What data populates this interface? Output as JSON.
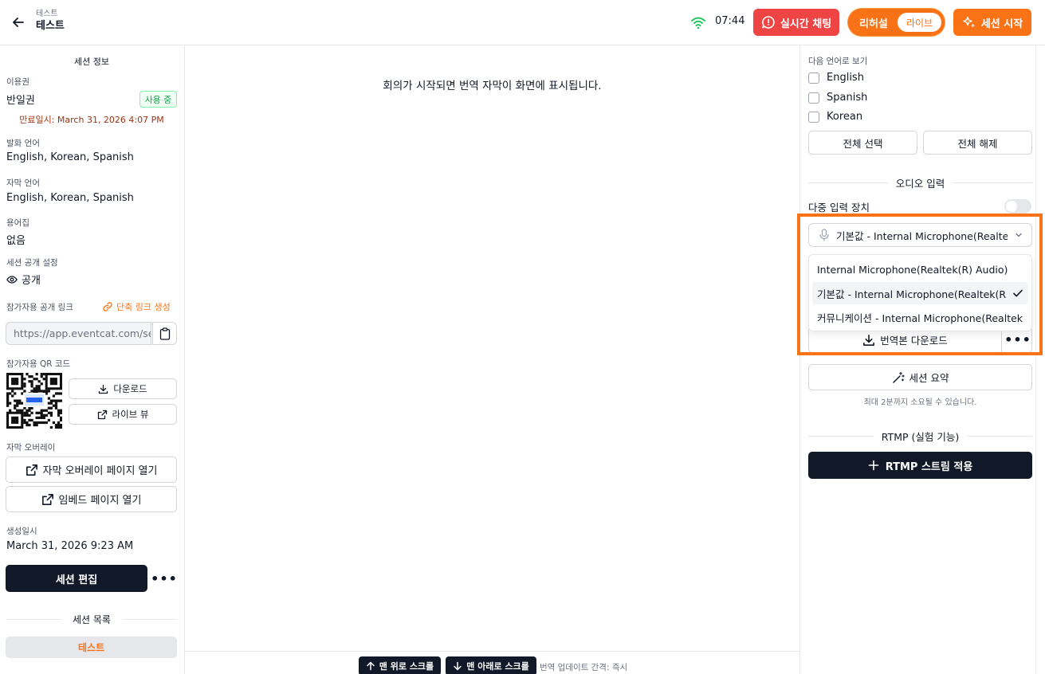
{
  "header": {
    "subtitle": "테스트",
    "title": "테스트",
    "time": "07:44",
    "chat_label": "실시간 채팅",
    "mode_rehearsal": "리허설",
    "mode_live": "라이브",
    "start_label": "세션 시작"
  },
  "left": {
    "panel_title": "세션 정보",
    "license_label": "이용권",
    "license_value": "반일권",
    "license_badge": "사용 중",
    "expire_text": "만료일시: March 31, 2026 4:07 PM",
    "speech_lang_label": "발화 언어",
    "speech_lang_value": "English, Korean, Spanish",
    "subtitle_lang_label": "자막 언어",
    "subtitle_lang_value": "English, Korean, Spanish",
    "glossary_label": "용어집",
    "glossary_value": "없음",
    "visibility_label": "세션 공개 설정",
    "visibility_value": "공개",
    "public_link_label": "참가자용 공개 링크",
    "short_link_label": "단축 링크 생성",
    "public_link_value": "https://app.eventcat.com/session/",
    "qr_label": "참가자용 QR 코드",
    "download_label": "다운로드",
    "live_view_label": "라이브 뷰",
    "overlay_label": "자막 오버레이",
    "overlay_open_label": "자막 오버레이 페이지 열기",
    "embed_open_label": "임베드 페이지 열기",
    "created_label": "생성일시",
    "created_value": "March 31, 2026 9:23 AM",
    "edit_label": "세션 편집",
    "list_title": "세션 목록",
    "list_items": [
      "테스트"
    ]
  },
  "center": {
    "placeholder": "회의가 시작되면 번역 자막이 화면에 표시됩니다.",
    "scroll_top_label": "맨 위로 스크롤",
    "scroll_bottom_label": "맨 아래로 스크롤",
    "update_interval": "번역 업데이트 간격: 즉시"
  },
  "right": {
    "view_lang_label": "다음 언어로 보기",
    "languages": [
      "English",
      "Spanish",
      "Korean"
    ],
    "select_all_label": "전체 선택",
    "deselect_all_label": "전체 해제",
    "audio_input_title": "오디오 입력",
    "multi_input_label": "다중 입력 장치",
    "selected_device": "기본값 - Internal Microphone(Realtek(R) Audio)",
    "device_options": [
      "Internal Microphone(Realtek(R) Audio)",
      "기본값 - Internal Microphone(Realtek(R) Audio)",
      "커뮤니케이션 - Internal Microphone(Realtek(R) Audio)"
    ],
    "download_translation_label": "번역본 다운로드",
    "summary_label": "세션 요약",
    "summary_note": "최대 2분까지 소요될 수 있습니다.",
    "rtmp_title": "RTMP (실험 기능)",
    "rtmp_button_label": "RTMP 스트림 적용"
  },
  "colors": {
    "accent": "#f97316",
    "danger": "#ef4444",
    "dark": "#111827",
    "success": "#16a34a"
  }
}
